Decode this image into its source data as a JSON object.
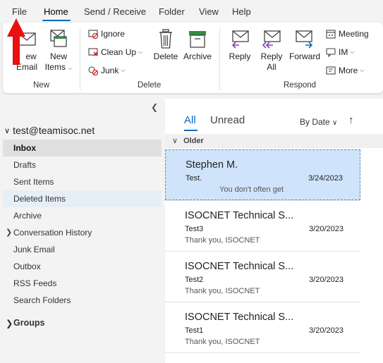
{
  "menu": {
    "file": "File",
    "home": "Home",
    "send_receive": "Send / Receive",
    "folder": "Folder",
    "view": "View",
    "help": "Help"
  },
  "ribbon": {
    "new_email_line1": "ew",
    "new_email_line2": "Email",
    "new_items_line1": "New",
    "new_items_line2": "Items",
    "new_group": "New",
    "ignore": "Ignore",
    "clean_up": "Clean Up",
    "junk": "Junk",
    "delete": "Delete",
    "archive": "Archive",
    "delete_group": "Delete",
    "reply": "Reply",
    "reply_all_line1": "Reply",
    "reply_all_line2": "All",
    "forward": "Forward",
    "meeting": "Meeting",
    "im": "IM",
    "more": "More",
    "respond_group": "Respond"
  },
  "folders": {
    "account": "test@teamisoc.net",
    "items": [
      "Inbox",
      "Drafts",
      "Sent Items",
      "Deleted Items",
      "Archive",
      "Conversation History",
      "Junk Email",
      "Outbox",
      "RSS Feeds",
      "Search Folders"
    ],
    "groups": "Groups"
  },
  "list": {
    "tab_all": "All",
    "tab_unread": "Unread",
    "sort": "By Date",
    "group": "Older",
    "messages": [
      {
        "sender": "Stephen M.",
        "subject": "Test.",
        "date": "3/24/2023",
        "preview": "You don't often get"
      },
      {
        "sender": "ISOCNET Technical S...",
        "subject": "Test3",
        "date": "3/20/2023",
        "preview": "Thank you,  ISOCNET"
      },
      {
        "sender": "ISOCNET Technical S...",
        "subject": "Test2",
        "date": "3/20/2023",
        "preview": "Thank you,  ISOCNET"
      },
      {
        "sender": "ISOCNET Technical S...",
        "subject": "Test1",
        "date": "3/20/2023",
        "preview": "Thank you,  ISOCNET"
      }
    ]
  },
  "colors": {
    "accent": "#0f6cbd",
    "selected_message": "#cfe4fa",
    "annotation_arrow": "#e81010"
  }
}
